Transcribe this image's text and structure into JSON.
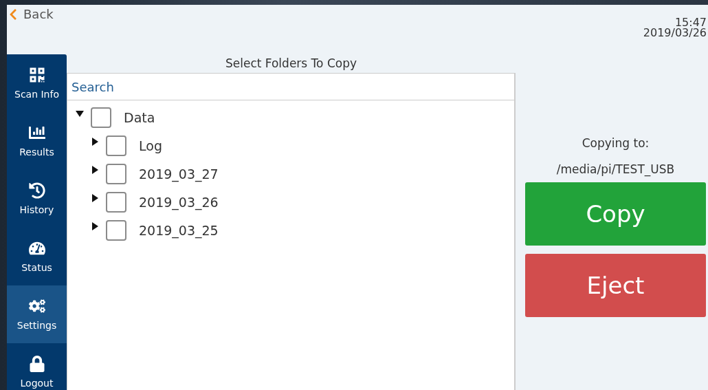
{
  "header": {
    "back_label": "Back",
    "time": "15:47",
    "date": "2019/03/26"
  },
  "sidebar": {
    "items": [
      {
        "label": "Scan Info",
        "selected": false
      },
      {
        "label": "Results",
        "selected": false
      },
      {
        "label": "History",
        "selected": false
      },
      {
        "label": "Status",
        "selected": false
      },
      {
        "label": "Settings",
        "selected": true
      },
      {
        "label": "Logout",
        "selected": false
      }
    ]
  },
  "folder_panel": {
    "title": "Select Folders To Copy",
    "search": {
      "placeholder": "Search"
    },
    "tree": [
      {
        "label": "Data",
        "expanded": true,
        "checked": false,
        "children": [
          {
            "label": "Log",
            "expanded": false,
            "checked": false
          },
          {
            "label": "2019_03_27",
            "expanded": false,
            "checked": false
          },
          {
            "label": "2019_03_26",
            "expanded": false,
            "checked": false
          },
          {
            "label": "2019_03_25",
            "expanded": false,
            "checked": false
          }
        ]
      }
    ]
  },
  "destination": {
    "label": "Copying to:",
    "path": "/media/pi/TEST_USB"
  },
  "buttons": [
    {
      "label": "Copy",
      "kind": "copy"
    },
    {
      "label": "Eject",
      "kind": "eject"
    }
  ]
}
